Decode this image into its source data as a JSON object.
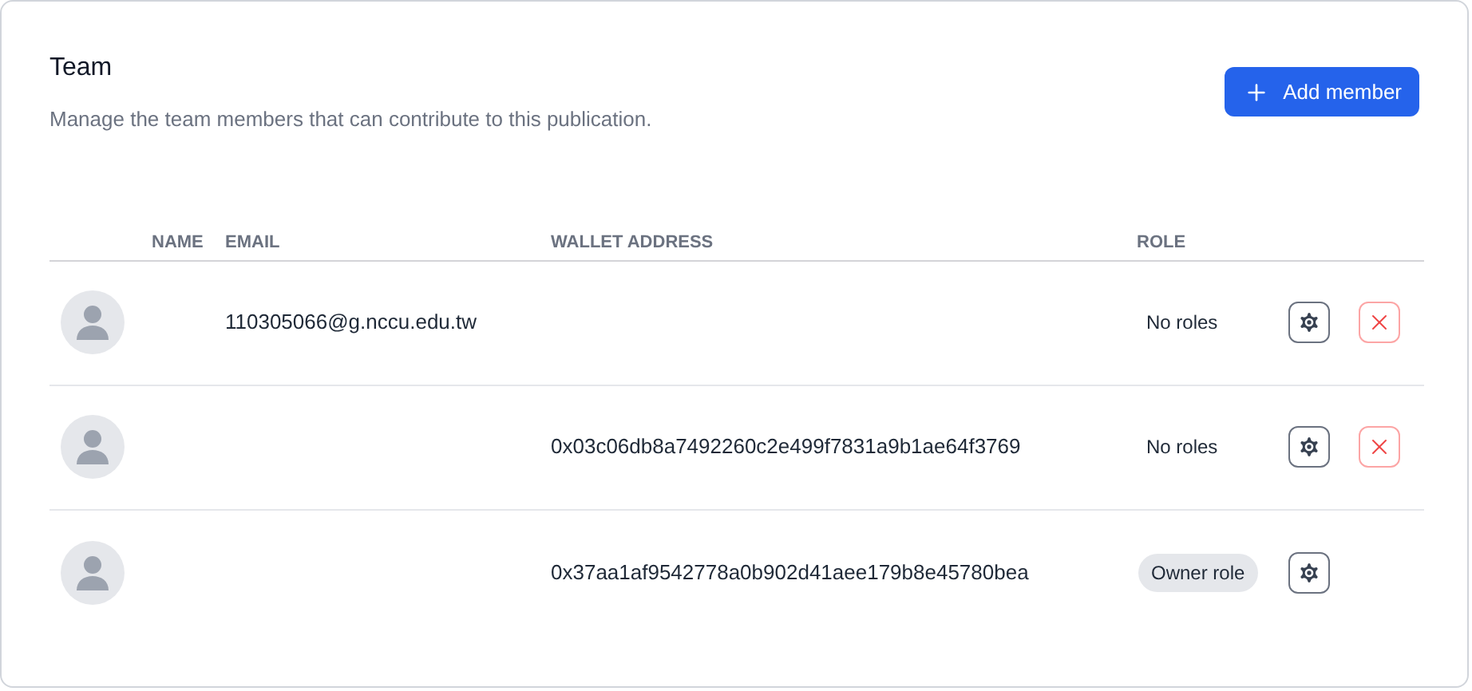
{
  "title": "Team",
  "description": "Manage the team members that can contribute to this publication.",
  "add_button": {
    "label": "Add member"
  },
  "table": {
    "columns": [
      "NAME",
      "EMAIL",
      "WALLET ADDRESS",
      "ROLE"
    ],
    "rows": [
      {
        "email": "110305066@g.nccu.edu.tw",
        "role": {
          "label": "No roles",
          "kind": "plain"
        },
        "removable": true
      },
      {
        "wallet": "0x03c06db8a7492260c2e499f7831a9b1ae64f3769",
        "role": {
          "label": "No roles",
          "kind": "plain"
        },
        "removable": true
      },
      {
        "wallet": "0x37aa1af9542778a0b902d41aee179b8e45780bea",
        "role": {
          "label": "Owner role",
          "kind": "pill"
        },
        "removable": false
      }
    ]
  }
}
